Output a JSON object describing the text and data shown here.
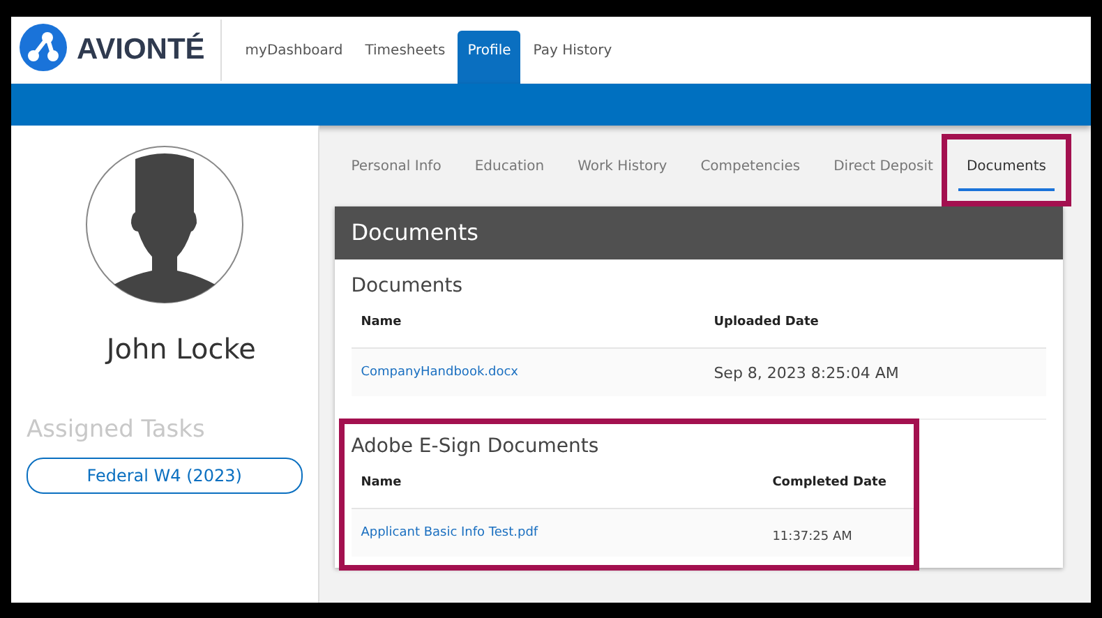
{
  "header": {
    "brand": "AVIONTÉ",
    "nav": [
      {
        "label": "myDashboard",
        "selected": false
      },
      {
        "label": "Timesheets",
        "selected": false
      },
      {
        "label": "Profile",
        "selected": true
      },
      {
        "label": "Pay History",
        "selected": false
      }
    ]
  },
  "profile": {
    "name": "John Locke",
    "tasks_title": "Assigned Tasks",
    "tasks": [
      "Federal W4 (2023)"
    ]
  },
  "tabs": [
    {
      "label": "Personal Info",
      "selected": false,
      "highlighted": false
    },
    {
      "label": "Education",
      "selected": false,
      "highlighted": false
    },
    {
      "label": "Work History",
      "selected": false,
      "highlighted": false
    },
    {
      "label": "Competencies",
      "selected": false,
      "highlighted": false
    },
    {
      "label": "Direct Deposit",
      "selected": false,
      "highlighted": false
    },
    {
      "label": "Documents",
      "selected": true,
      "highlighted": true
    }
  ],
  "card": {
    "title": "Documents",
    "sections": [
      {
        "title": "Documents",
        "highlighted": false,
        "columns": [
          "Name",
          "Uploaded Date"
        ],
        "rows": [
          [
            "CompanyHandbook.docx",
            "Sep 8, 2023 8:25:04 AM"
          ]
        ]
      },
      {
        "title": "Adobe E-Sign Documents",
        "highlighted": true,
        "columns": [
          "Name",
          "Completed Date"
        ],
        "rows": [
          [
            "Applicant Basic Info Test.pdf",
            "11:37:25 AM"
          ]
        ]
      }
    ]
  }
}
